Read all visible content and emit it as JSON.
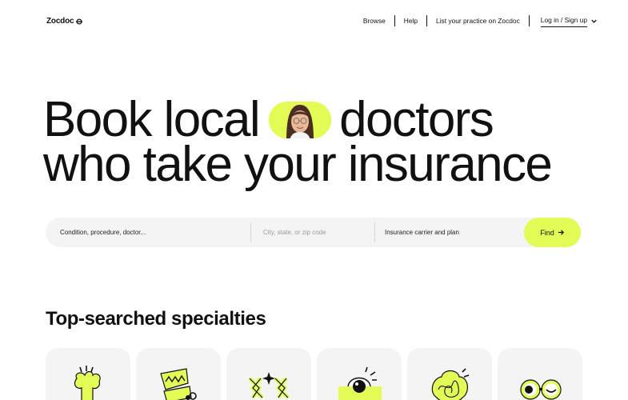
{
  "header": {
    "logo": "Zocdoc",
    "nav": [
      "Browse",
      "Help",
      "List your practice on Zocdoc"
    ],
    "login": "Log in / Sign up"
  },
  "hero": {
    "line1_before": "Book local",
    "line1_after": "doctors",
    "line2": "who take your insurance"
  },
  "search": {
    "condition_placeholder": "Condition, procedure, doctor...",
    "location_placeholder": "City, state, or zip code",
    "insurance_placeholder": "Insurance carrier and plan",
    "find_label": "Find"
  },
  "specialties": {
    "title": "Top-searched specialties",
    "icons": [
      "primary-care-icon",
      "dentist-icon",
      "dermatologist-icon",
      "eye-doctor-icon",
      "psychiatrist-icon",
      "optometrist-icon"
    ]
  },
  "colors": {
    "accent": "#e4fa55",
    "input_bg": "#f4f4f4",
    "text": "#111111"
  }
}
